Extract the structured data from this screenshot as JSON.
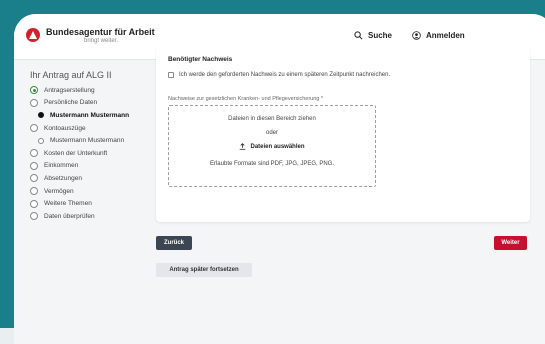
{
  "header": {
    "brand": "Bundesagentur für Arbeit",
    "tagline": "bringt weiter.",
    "search_label": "Suche",
    "login_label": "Anmelden"
  },
  "sidebar": {
    "title": "Ihr Antrag auf ALG II",
    "steps": [
      {
        "label": "Antragserstellung",
        "state": "done"
      },
      {
        "label": "Persönliche Daten",
        "state": "open"
      },
      {
        "label": "Mustermann Mustermann",
        "state": "active"
      },
      {
        "label": "Kontoauszüge",
        "state": "open"
      },
      {
        "label": "Mustermann Mustermann",
        "state": "sub"
      },
      {
        "label": "Kosten der Unterkunft",
        "state": "open"
      },
      {
        "label": "Einkommen",
        "state": "open"
      },
      {
        "label": "Absetzungen",
        "state": "open"
      },
      {
        "label": "Vermögen",
        "state": "open"
      },
      {
        "label": "Weitere Themen",
        "state": "open"
      },
      {
        "label": "Daten überprüfen",
        "state": "open"
      }
    ]
  },
  "main": {
    "section_title": "Benötigter Nachweis",
    "checkbox_label": "Ich werde den geforderten Nachweis zu einem späteren Zeitpunkt nachreichen.",
    "upload_label": "Nachweise zur gesetzlichen Kranken- und Pflegeversicherung *",
    "dropzone_text": "Dateien in diesen Bereich ziehen",
    "dropzone_or": "oder",
    "dropzone_button": "Dateien auswählen",
    "dropzone_formats": "Erlaubte Formate sind PDF, JPG, JPEG, PNG."
  },
  "actions": {
    "back": "Zurück",
    "next": "Weiter",
    "save_later": "Antrag später fortsetzen"
  },
  "colors": {
    "frame": "#1a7f8a",
    "brand_red": "#c8102e",
    "back_button": "#3b4652"
  }
}
